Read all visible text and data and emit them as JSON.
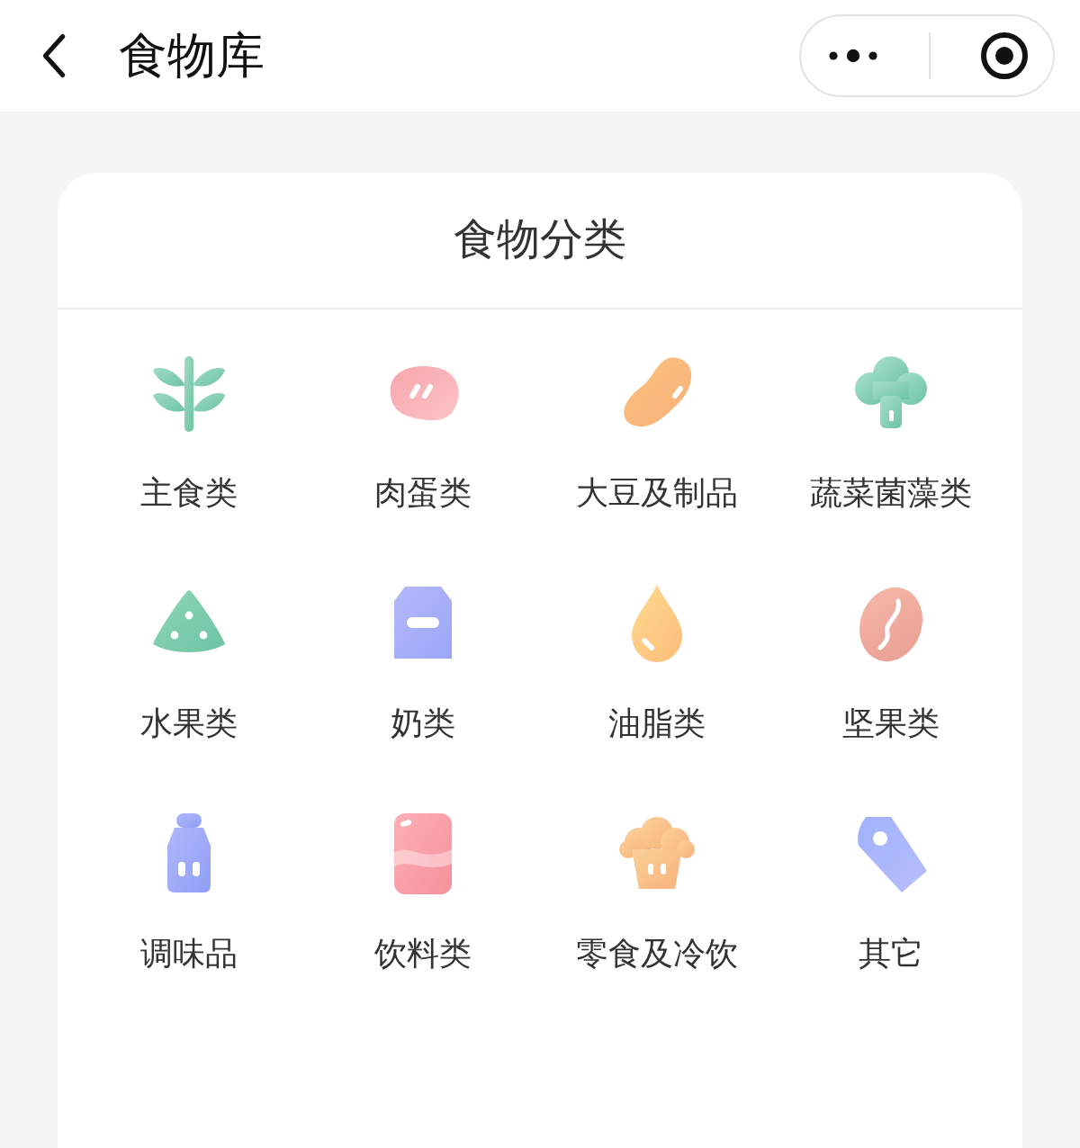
{
  "header": {
    "title": "食物库"
  },
  "card": {
    "title": "食物分类",
    "categories": [
      {
        "label": "主食类",
        "kind": "grain"
      },
      {
        "label": "肉蛋类",
        "kind": "meat"
      },
      {
        "label": "大豆及制品",
        "kind": "bean"
      },
      {
        "label": "蔬菜菌藻类",
        "kind": "vegetable"
      },
      {
        "label": "水果类",
        "kind": "fruit"
      },
      {
        "label": "奶类",
        "kind": "milk"
      },
      {
        "label": "油脂类",
        "kind": "oil"
      },
      {
        "label": "坚果类",
        "kind": "nut"
      },
      {
        "label": "调味品",
        "kind": "seasoning"
      },
      {
        "label": "饮料类",
        "kind": "drink"
      },
      {
        "label": "零食及冷饮",
        "kind": "snack"
      },
      {
        "label": "其它",
        "kind": "tag"
      }
    ]
  }
}
